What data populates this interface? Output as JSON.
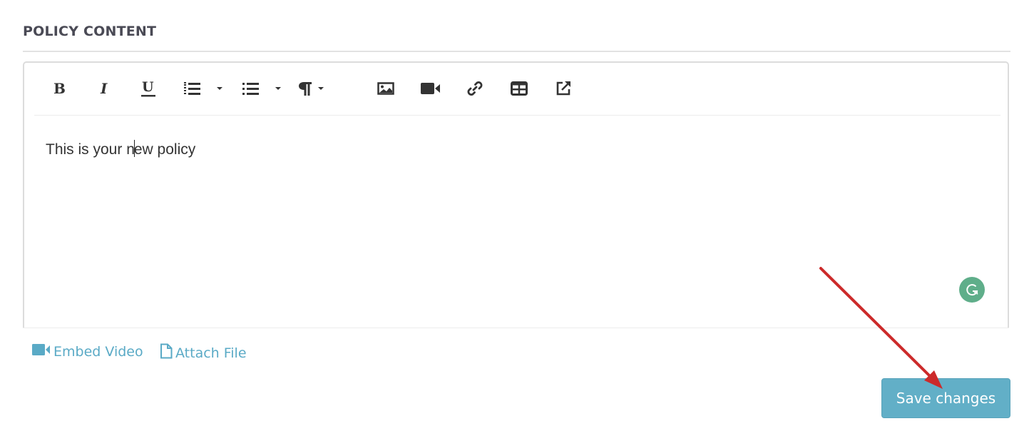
{
  "section": {
    "title": "POLICY CONTENT"
  },
  "toolbar": {
    "buttons": [
      {
        "name": "bold",
        "icon": "bold-icon"
      },
      {
        "name": "italic",
        "icon": "italic-icon"
      },
      {
        "name": "underline",
        "icon": "underline-icon"
      },
      {
        "name": "ordered-list",
        "icon": "ordered-list-icon",
        "dropdown": true
      },
      {
        "name": "unordered-list",
        "icon": "unordered-list-icon",
        "dropdown": true
      },
      {
        "name": "paragraph",
        "icon": "paragraph-icon",
        "dropdown": true
      },
      {
        "name": "insert-image",
        "icon": "image-icon"
      },
      {
        "name": "insert-video",
        "icon": "video-icon"
      },
      {
        "name": "insert-link",
        "icon": "link-icon"
      },
      {
        "name": "insert-table",
        "icon": "table-icon"
      },
      {
        "name": "open-external",
        "icon": "external-link-icon"
      }
    ]
  },
  "editor": {
    "content_before_cursor": "This is your n",
    "content_after_cursor": "ew policy"
  },
  "attachments": {
    "embed_video_label": "Embed Video",
    "attach_file_label": "Attach File"
  },
  "actions": {
    "save_label": "Save changes"
  },
  "colors": {
    "accent": "#62afc7",
    "link": "#5aaac6",
    "grammarly": "#5fae8a",
    "annotation_arrow": "#cc2a2a"
  }
}
